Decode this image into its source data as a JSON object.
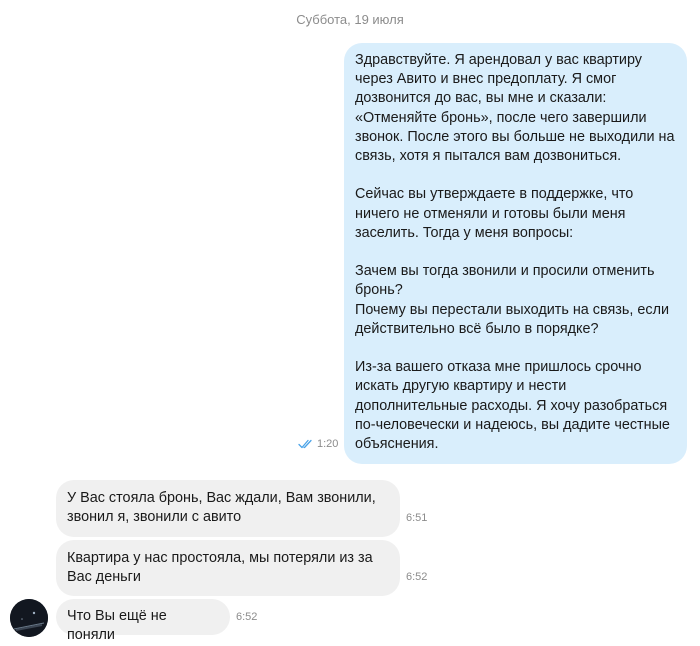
{
  "chat": {
    "date_separator": "Суббота, 19 июля",
    "outgoing": {
      "paragraphs": [
        "Здравствуйте. Я арендовал у вас квартиру через Авито и внес предоплату. Я смог дозвонится до вас, вы мне и сказали: «Отменяйте бронь», после чего завершили звонок. После этого вы больше не выходили на связь, хотя я пытался вам дозвониться.",
        "Сейчас вы утверждаете в поддержке, что ничего не отменяли и готовы были меня заселить. Тогда у меня вопросы:",
        "Зачем вы тогда звонили и просили отменить бронь?\nПочему вы перестали выходить на связь, если действительно всё было в порядке?",
        "Из-за вашего отказа мне пришлось срочно искать другую квартиру и нести дополнительные расходы. Я хочу разобраться по-человечески и надеюсь, вы дадите честные объяснения."
      ],
      "time": "1:20",
      "status_icon": "double-check-read-icon"
    },
    "incoming": [
      {
        "text": "У Вас стояла бронь, Вас ждали, Вам звонили, звонил я, звонили с авито",
        "time": "6:51"
      },
      {
        "text": "Квартира у нас простояла, мы потеряли из за Вас деньги",
        "time": "6:52"
      },
      {
        "text": "Что Вы ещё не поняли",
        "time": "6:52"
      }
    ],
    "colors": {
      "outgoing_bubble": "#d9eefc",
      "incoming_bubble": "#f0f0f0",
      "meta_text": "#8c8c8c",
      "read_check": "#4aa3e8"
    }
  }
}
